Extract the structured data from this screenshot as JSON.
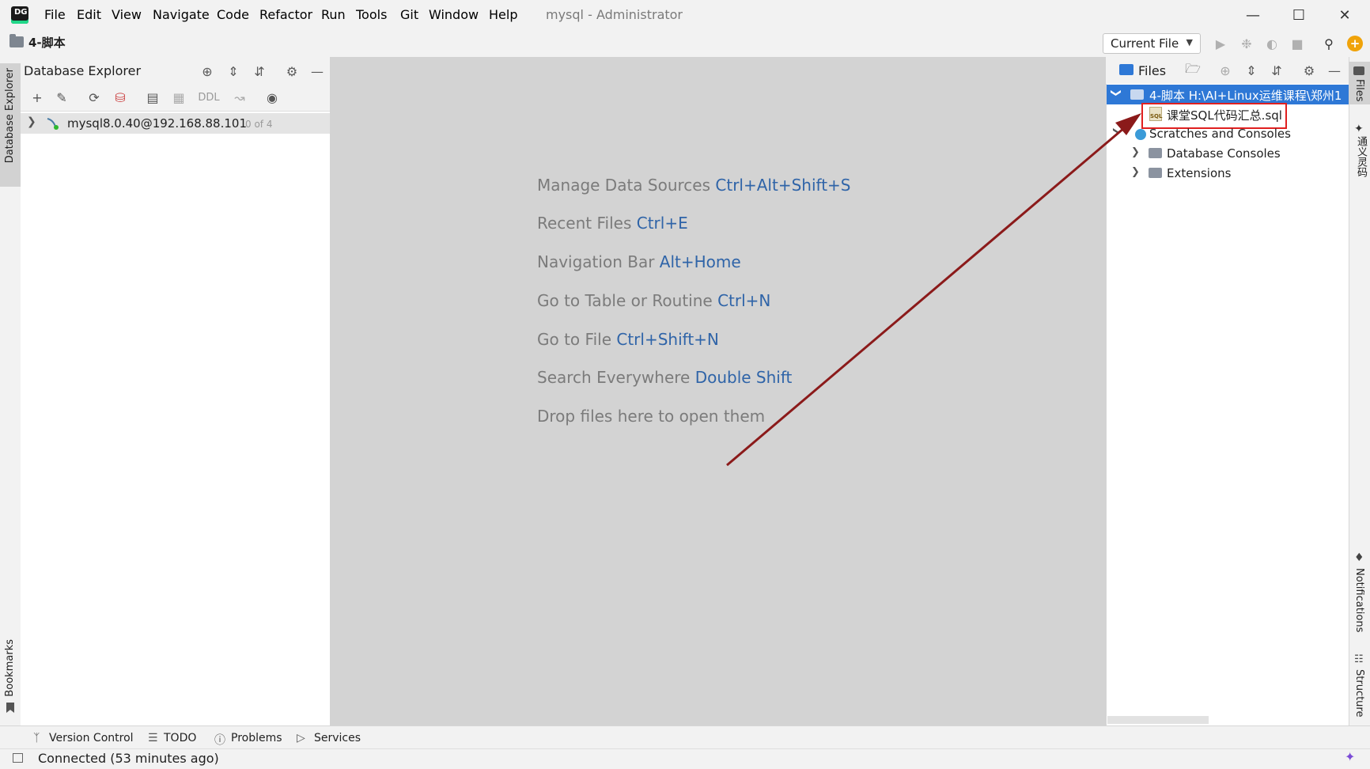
{
  "app": {
    "window_title": "mysql - Administrator",
    "menu": [
      "File",
      "Edit",
      "View",
      "Navigate",
      "Code",
      "Refactor",
      "Run",
      "Tools",
      "Git",
      "Window",
      "Help"
    ],
    "logo_text": "DG"
  },
  "navbar": {
    "breadcrumb": "4-脚本",
    "run_config": "Current File"
  },
  "left_strip": {
    "db_explorer_tab": "Database Explorer",
    "bookmarks_tab": "Bookmarks"
  },
  "db_explorer": {
    "title": "Database Explorer",
    "toolbar_ddl": "DDL",
    "datasource": {
      "label": "mysql8.0.40@192.168.88.101",
      "count": "0 of 4"
    }
  },
  "editor": {
    "hints": [
      {
        "text": "Manage Data Sources",
        "shortcut": "Ctrl+Alt+Shift+S"
      },
      {
        "text": "Recent Files",
        "shortcut": "Ctrl+E"
      },
      {
        "text": "Navigation Bar",
        "shortcut": "Alt+Home"
      },
      {
        "text": "Go to Table or Routine",
        "shortcut": "Ctrl+N"
      },
      {
        "text": "Go to File",
        "shortcut": "Ctrl+Shift+N"
      },
      {
        "text": "Search Everywhere",
        "shortcut": "Double Shift"
      },
      {
        "text": "Drop files here to open them",
        "shortcut": ""
      }
    ]
  },
  "files_panel": {
    "title": "Files",
    "root": "4-脚本  H:\\AI+Linux运维课程\\郑州1",
    "sql_file": "课堂SQL代码汇总.sql",
    "sql_icon_text": "SQL",
    "scratches": "Scratches and Consoles",
    "db_consoles": "Database Consoles",
    "extensions": "Extensions"
  },
  "right_strip": {
    "files_tab": "Files",
    "tongyi_tab": "通义灵码",
    "notifications_tab": "Notifications",
    "structure_tab": "Structure"
  },
  "tool_tabs": [
    "Version Control",
    "TODO",
    "Problems",
    "Services"
  ],
  "status": {
    "text": "Connected (53 minutes ago)"
  },
  "colors": {
    "accent": "#2e78d6",
    "highlight_box": "#e02020",
    "annotation_arrow": "#8b1a1a",
    "shortcut": "#2f64a8"
  }
}
